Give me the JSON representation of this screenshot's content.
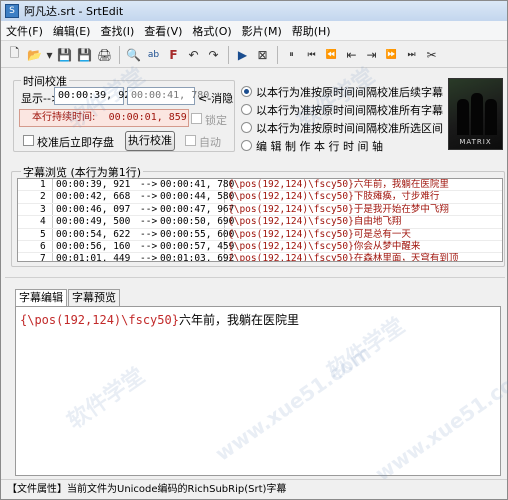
{
  "window": {
    "title": "阿凡达.srt - SrtEdit"
  },
  "menu": [
    {
      "label": "文件(F)"
    },
    {
      "label": "编辑(E)"
    },
    {
      "label": "查找(I)"
    },
    {
      "label": "查看(V)"
    },
    {
      "label": "格式(O)"
    },
    {
      "label": "影片(M)"
    },
    {
      "label": "帮助(H)"
    }
  ],
  "toolbar": {
    "icons": [
      "new-file-icon",
      "open-folder-icon",
      "dropdown-arrow-icon",
      "save-icon",
      "save-as-icon",
      "print-icon",
      "find-icon",
      "replace-icon",
      "font-icon",
      "undo-icon",
      "redo-icon",
      "play-icon",
      "frame-icon",
      "pause-icon",
      "to-start-icon",
      "rewind-icon",
      "step-back-icon",
      "step-forward-icon",
      "fast-forward-icon",
      "to-end-icon",
      "scissor-icon"
    ],
    "glyphs": [
      "🗋",
      "📂",
      "▾",
      "💾",
      "💾",
      "🖨",
      "🔍",
      "ab",
      "F",
      "↶",
      "↷",
      "▶",
      "⊠",
      "⏸",
      "⏮",
      "⏪",
      "⇤",
      "⇥",
      "⏩",
      "⏭",
      "✂"
    ]
  },
  "timing": {
    "group_title": "时间校准",
    "display_label": "显示-->",
    "time_start": "00:00:39, 921",
    "time_end": "00:00:41, 780",
    "cancel_label": "<-消隐",
    "duration_label": "本行持续时间:",
    "duration_value": "00:00:01, 859",
    "lock_label": "锁定",
    "post_check_label": "校准后立即存盘",
    "exec_button": "执行校准",
    "auto_label": "自动"
  },
  "radios": [
    {
      "label": "以本行为准按原时间间隔校准后续字幕",
      "selected": true
    },
    {
      "label": "以本行为准按原时间间隔校准所有字幕",
      "selected": false
    },
    {
      "label": "以本行为准按原时间间隔校准所选区间",
      "selected": false
    },
    {
      "label": "编 辑 制 作 本 行 时 间 轴",
      "selected": false
    }
  ],
  "poster": {
    "title": "MATRIX"
  },
  "browser": {
    "group_title": "字幕浏览 (本行为第1行)",
    "rows": [
      {
        "no": "1",
        "start": "00:00:39, 921",
        "arrow": "-->",
        "end": "00:00:41, 780",
        "text": "{\\pos(192,124)\\fscy50}六年前，我躺在医院里"
      },
      {
        "no": "2",
        "start": "00:00:42, 668",
        "arrow": "-->",
        "end": "00:00:44, 580",
        "text": "{\\pos(192,124)\\fscy50}下肢瘫痪，寸步难行"
      },
      {
        "no": "3",
        "start": "00:00:46, 097",
        "arrow": "-->",
        "end": "00:00:47, 967",
        "text": "{\\pos(192,124)\\fscy50}于是我开始在梦中飞翔"
      },
      {
        "no": "4",
        "start": "00:00:49, 500",
        "arrow": "-->",
        "end": "00:00:50, 690",
        "text": "{\\pos(192,124)\\fscy50}自由地飞翔"
      },
      {
        "no": "5",
        "start": "00:00:54, 622",
        "arrow": "-->",
        "end": "00:00:55, 600",
        "text": "{\\pos(192,124)\\fscy50}可是总有一天"
      },
      {
        "no": "6",
        "start": "00:00:56, 160",
        "arrow": "-->",
        "end": "00:00:57, 459",
        "text": "{\\pos(192,124)\\fscy50}你会从梦中醒来"
      },
      {
        "no": "7",
        "start": "00:01:01, 449",
        "arrow": "-->",
        "end": "00:01:03, 692",
        "text": "{\\pos(192,124)\\fscy50}在森林里面，天穹有到顶"
      }
    ]
  },
  "tabs": [
    {
      "label": "字幕编辑",
      "active": true
    },
    {
      "label": "字幕预览",
      "active": false
    }
  ],
  "editor": {
    "tag": "{\\pos(192,124)\\fscy50}",
    "text": "六年前，我躺在医院里"
  },
  "status": {
    "text": "【文件属性】当前文件为Unicode编码的RichSubRip(Srt)字幕"
  },
  "watermark": {
    "text1": "软件学堂",
    "text2": "www.xue51.com"
  }
}
